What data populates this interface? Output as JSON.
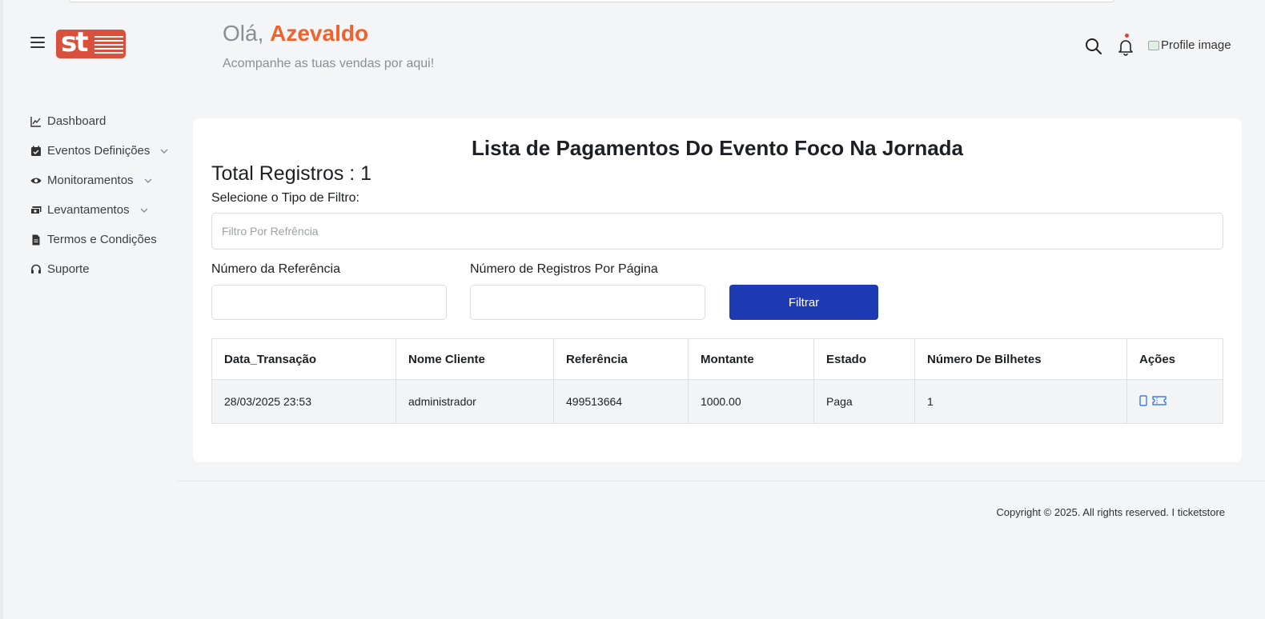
{
  "header": {
    "greeting_prefix": "Olá,",
    "user_name": "Azevaldo",
    "subtitle": "Acompanhe as tuas vendas por aqui!",
    "profile_alt": "Profile image",
    "logo_text": "st"
  },
  "sidebar": {
    "items": [
      {
        "label": "Dashboard",
        "icon": "chart-line-icon",
        "expandable": false
      },
      {
        "label": "Eventos Definições",
        "icon": "calendar-icon",
        "expandable": true
      },
      {
        "label": "Monitoramentos",
        "icon": "eye-icon",
        "expandable": true
      },
      {
        "label": "Levantamentos",
        "icon": "money-icon",
        "expandable": true
      },
      {
        "label": "Termos e Condições",
        "icon": "document-icon",
        "expandable": false
      },
      {
        "label": "Suporte",
        "icon": "headset-icon",
        "expandable": false
      }
    ]
  },
  "main": {
    "title": "Lista de Pagamentos Do Evento Foco Na Jornada",
    "total": "Total Registros : 1",
    "filter_type_label": "Selecione o Tipo de Filtro:",
    "filter_type_value": "Filtro Por Refrência",
    "ref_label": "Número da Referência",
    "ref_value": "",
    "per_page_label": "Número de Registros Por Página",
    "per_page_value": "",
    "filter_button": "Filtrar",
    "table": {
      "columns": [
        "Data_Transação",
        "Nome Cliente",
        "Referência",
        "Montante",
        "Estado",
        "Número De Bilhetes",
        "Ações"
      ],
      "rows": [
        [
          "28/03/2025 23:53",
          "administrador",
          "499513664",
          "1000.00",
          "Paga",
          "1"
        ]
      ]
    }
  },
  "footer": {
    "copyright": "Copyright © 2025. All rights reserved. I ticketstore"
  },
  "colors": {
    "accent_orange": "#f0612e",
    "primary_blue": "#1f3bb3",
    "logo_red": "#d9503c"
  }
}
